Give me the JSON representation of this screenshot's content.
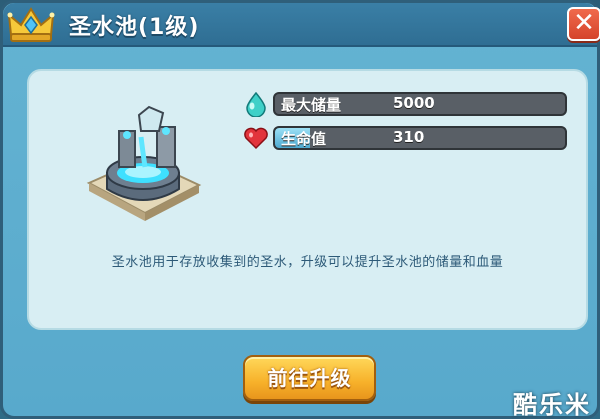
{
  "dialog": {
    "title": "圣水池(1级)",
    "close_label": "✕"
  },
  "stats": [
    {
      "label": "最大储量",
      "value": "5000",
      "icon": "water-drop-icon",
      "fill": 0.0
    },
    {
      "label": "生命值",
      "value": "310",
      "icon": "heart-icon",
      "fill": 0.12
    }
  ],
  "description": "圣水池用于存放收集到的圣水，升级可以提升圣水池的储量和血量",
  "upgrade_button": "前往升级",
  "watermark": "酷乐米",
  "colors": {
    "panel_bg": "#d8eef3",
    "dialog_bg": "#64b3d2",
    "button_gold": "#f7b12a",
    "close_red": "#e0553a"
  }
}
